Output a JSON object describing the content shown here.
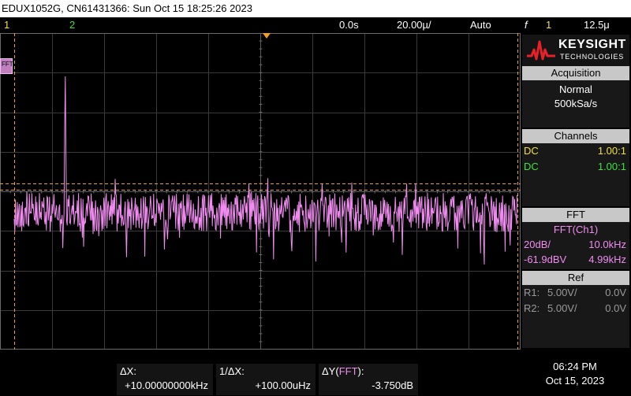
{
  "title_bar": {
    "text": "EDUX1052G, CN61431366: Sun Oct 15 18:25:26 2023"
  },
  "top_bar": {
    "ch1_label": "1",
    "ch2_label": "2",
    "delay": "0.0s",
    "timebase": "20.00µ/",
    "trigger_mode": "Auto",
    "trigger_source": "1",
    "trigger_level": "12.5μ",
    "trigger_symbol": "f"
  },
  "waveform": {
    "fft_marker": "FFT",
    "trace_color": "#f08cf0"
  },
  "logo": {
    "brand": "KEYSIGHT",
    "sub": "TECHNOLOGIES"
  },
  "acquisition": {
    "header": "Acquisition",
    "mode": "Normal",
    "rate": "500kSa/s"
  },
  "channels": {
    "header": "Channels",
    "rows": [
      {
        "coupling": "DC",
        "probe": "1.00:1",
        "color": "#f0e040"
      },
      {
        "coupling": "DC",
        "probe": "1.00:1",
        "color": "#40e040"
      }
    ]
  },
  "fft": {
    "header": "FFT",
    "source": "FFT(Ch1)",
    "scale": "20dB/",
    "span": "10.0kHz",
    "offset": "-61.9dBV",
    "center": "4.99kHz"
  },
  "ref": {
    "header": "Ref",
    "rows": [
      {
        "name": "R1:",
        "scale": "5.00V/",
        "offset": "0.0V"
      },
      {
        "name": "R2:",
        "scale": "5.00V/",
        "offset": "0.0V"
      }
    ]
  },
  "measurements": {
    "dx_label": "ΔX:",
    "dx_value": "+10.00000000kHz",
    "inv_dx_label": "1/ΔX:",
    "inv_dx_value": "+100.00uHz",
    "dy_label_prefix": "ΔY(",
    "dy_label_src": "FFT",
    "dy_label_suffix": "):",
    "dy_value": "-3.750dB"
  },
  "clock": {
    "time": "06:24 PM",
    "date": "Oct 15, 2023"
  }
}
